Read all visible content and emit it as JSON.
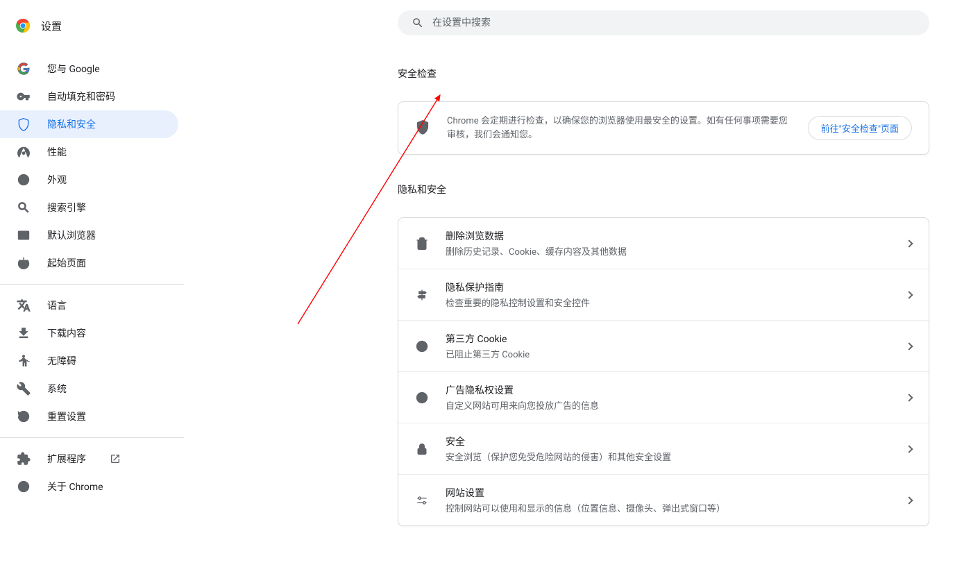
{
  "header": {
    "title": "设置"
  },
  "search": {
    "placeholder": "在设置中搜索"
  },
  "sidebar": {
    "items": [
      {
        "label": "您与 Google"
      },
      {
        "label": "自动填充和密码"
      },
      {
        "label": "隐私和安全"
      },
      {
        "label": "性能"
      },
      {
        "label": "外观"
      },
      {
        "label": "搜索引擎"
      },
      {
        "label": "默认浏览器"
      },
      {
        "label": "起始页面"
      }
    ],
    "items2": [
      {
        "label": "语言"
      },
      {
        "label": "下载内容"
      },
      {
        "label": "无障碍"
      },
      {
        "label": "系统"
      },
      {
        "label": "重置设置"
      }
    ],
    "items3": [
      {
        "label": "扩展程序"
      },
      {
        "label": "关于 Chrome"
      }
    ]
  },
  "safety": {
    "heading": "安全检查",
    "description": "Chrome 会定期进行检查，以确保您的浏览器使用最安全的设置。如有任何事项需要您审核，我们会通知您。",
    "button": "前往\"安全检查\"页面"
  },
  "privacy": {
    "heading": "隐私和安全",
    "rows": [
      {
        "title": "删除浏览数据",
        "subtitle": "删除历史记录、Cookie、缓存内容及其他数据"
      },
      {
        "title": "隐私保护指南",
        "subtitle": "检查重要的隐私控制设置和安全控件"
      },
      {
        "title": "第三方 Cookie",
        "subtitle": "已阻止第三方 Cookie"
      },
      {
        "title": "广告隐私权设置",
        "subtitle": "自定义网站可用来向您投放广告的信息"
      },
      {
        "title": "安全",
        "subtitle": "安全浏览（保护您免受危险网站的侵害）和其他安全设置"
      },
      {
        "title": "网站设置",
        "subtitle": "控制网站可以使用和显示的信息（位置信息、摄像头、弹出式窗口等）"
      }
    ]
  }
}
